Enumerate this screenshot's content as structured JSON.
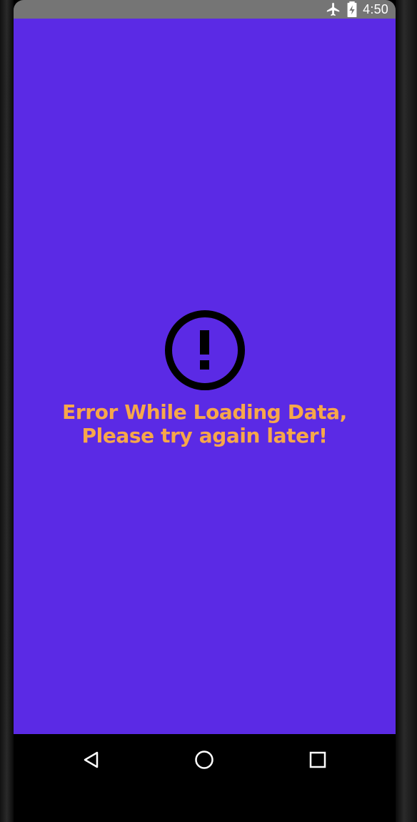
{
  "status_bar": {
    "time": "4:50",
    "icons": [
      "airplane-mode-icon",
      "battery-charging-icon"
    ]
  },
  "error": {
    "icon": "error-outline-icon",
    "line1": "Error While Loading Data,",
    "line2": "Please try again later!"
  },
  "nav_bar": {
    "buttons": [
      "back-button",
      "home-button",
      "recents-button"
    ]
  },
  "colors": {
    "background": "#5b2ae5",
    "error_text": "#f7a74a",
    "status_bar": "#757575",
    "icon": "#000000"
  }
}
